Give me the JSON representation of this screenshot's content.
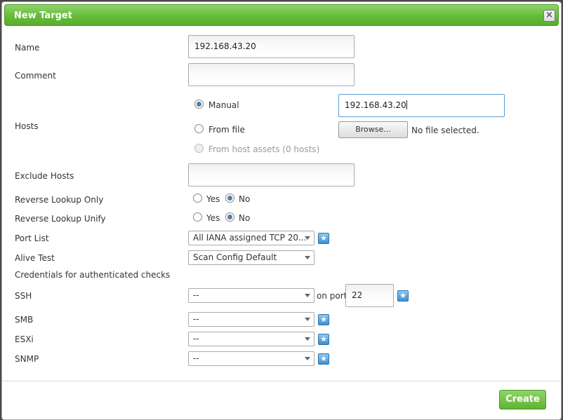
{
  "dialog": {
    "title": "New Target",
    "close_icon": "close-icon",
    "create_label": "Create"
  },
  "form": {
    "name_label": "Name",
    "name_value": "192.168.43.20",
    "comment_label": "Comment",
    "comment_value": "",
    "hosts_label": "Hosts",
    "hosts_manual_label": "Manual",
    "hosts_manual_value": "192.168.43.20",
    "hosts_fromfile_label": "From file",
    "browse_label": "Browse...",
    "no_file_label": "No file selected.",
    "hosts_assets_label": "From host assets (0 hosts)",
    "hosts_selected": "Manual",
    "exclude_label": "Exclude Hosts",
    "exclude_value": "",
    "reverse_only_label": "Reverse Lookup Only",
    "reverse_unify_label": "Reverse Lookup Unify",
    "yes_label": "Yes",
    "no_label": "No",
    "reverse_only_selected": "No",
    "reverse_unify_selected": "No",
    "port_list_label": "Port List",
    "port_list_value": "All IANA assigned TCP 20...",
    "alive_test_label": "Alive Test",
    "alive_test_value": "Scan Config Default",
    "credentials_heading": "Credentials for authenticated checks",
    "ssh_label": "SSH",
    "ssh_value": "--",
    "on_port_label": "on port",
    "ssh_port": "22",
    "smb_label": "SMB",
    "smb_value": "--",
    "esxi_label": "ESXi",
    "esxi_value": "--",
    "snmp_label": "SNMP",
    "snmp_value": "--",
    "new_icon": "star-icon"
  },
  "colors": {
    "titlebar_green": "#66bb3a",
    "create_green": "#5fb334",
    "star_blue": "#3b8fd1",
    "focus_blue": "#5b9bd5"
  }
}
